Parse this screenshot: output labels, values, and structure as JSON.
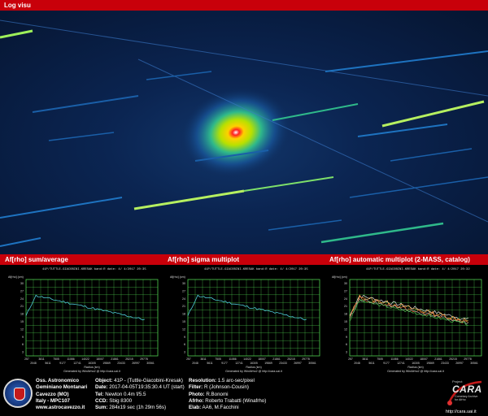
{
  "top_bar": {
    "title": "Log visu"
  },
  "mid_bar": {
    "panel1_title": "Af[rho] sum/average",
    "panel2_title": "Af[rho] sigma multiplot",
    "panel3_title": "Af[rho] automatic multiplot (2-MASS, catalog)"
  },
  "plots": {
    "header_text": "41P/TUTTLE-GIACOBINI-KRESAK  band:R date: 4/ 4/2017 20:35",
    "header_text_3": "41P/TUTTLE-GIACOBINI-KRESAK  band:R date: 4/ 4/2017 20:32",
    "y_axis_label": "Af[rho] (cm)",
    "x_axis_label": "Radius (km)",
    "footer_text": "Generated by WinAfrho2 @ http://cara.uai.it",
    "x_ticks_top": [
      "257",
      "3811",
      "7505",
      "11086",
      "14022",
      "18007",
      "21861",
      "25215",
      "29778"
    ],
    "x_ticks_bottom": [
      "2048",
      "5611",
      "9177",
      "12741",
      "16305",
      "19869",
      "23433",
      "26997",
      "30561"
    ],
    "y_ticks": [
      "30",
      "27",
      "24",
      "21",
      "18",
      "15",
      "12",
      "9",
      "6",
      "3"
    ]
  },
  "footer": {
    "obs_line1": "Oss. Astronomico",
    "obs_line2": "Geminiano Montanari",
    "obs_line3": "Cavezzo (MO)",
    "obs_line4": "Italy - MPC107",
    "obs_line5": "www.astrocavezzo.it",
    "object_label": "Object:",
    "object_value": "41P - (Tuttle-Giacobini-Kresak)",
    "date_label": "Date:",
    "date_value": "2017-04-05T19:35:30.4 UT (start)",
    "tel_label": "Tel:",
    "tel_value": "Newton 0.4m f/5.5",
    "ccd_label": "CCD:",
    "ccd_value": "Sbig 8300",
    "sum_label": "Sum:",
    "sum_value": "284x19 sec (1h 29m 56s)",
    "res_label": "Resolution:",
    "res_value": "1.5 arc-sec/pixel",
    "filter_label": "Filter:",
    "filter_value": "R (Johnson-Cousin)",
    "photo_label": "Photo:",
    "photo_value": "R.Bonomi",
    "afrho_label": "Afrho:",
    "afrho_value": "Roberto Trabatti (Winafrho)",
    "elab_label": "Elab:",
    "elab_value": "AA6, M.Facchini",
    "cara_project": "Project",
    "cara_name": "CARA",
    "cara_sub1": "Cometary Archive",
    "cara_sub2": "for Afrho",
    "cara_url": "http://cara.uai.it"
  },
  "colors": {
    "accent_red": "#c8000a",
    "grid_green": "#4fd04f",
    "curve_cyan": "#4ecad6"
  }
}
